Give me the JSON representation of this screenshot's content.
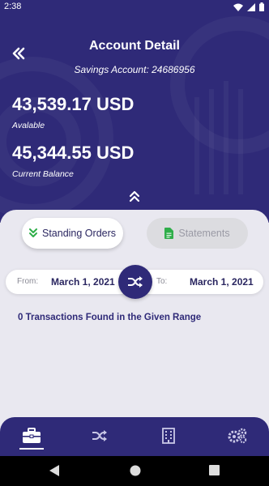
{
  "status_bar": {
    "time": "2:38",
    "icons": [
      "wifi-icon",
      "signal-icon",
      "battery-icon"
    ]
  },
  "header": {
    "title": "Account Detail",
    "subtitle": "Savings Account: 24686956",
    "available_amount": "43,539.17 USD",
    "available_label": "Avalable",
    "balance_amount": "45,344.55 USD",
    "balance_label": "Current Balance",
    "back_icon": "double-chevron-left-icon",
    "collapse_icon": "double-chevron-up-icon"
  },
  "tabs": {
    "standing_orders": "Standing Orders",
    "statements": "Statements",
    "active": "standing_orders"
  },
  "date_range": {
    "from_label": "From:",
    "from_value": "March 1, 2021",
    "to_label": "To:",
    "to_value": "March 1, 2021",
    "swap_icon": "shuffle-icon"
  },
  "result": {
    "message": "0 Transactions Found in the Given Range"
  },
  "bottom_nav": {
    "items": [
      "briefcase-icon",
      "shuffle-icon",
      "building-icon",
      "settings-icon"
    ],
    "active_index": 0
  },
  "colors": {
    "primary": "#2f2a78",
    "accent_green": "#2fae4a",
    "background": "#e9e8f0"
  }
}
